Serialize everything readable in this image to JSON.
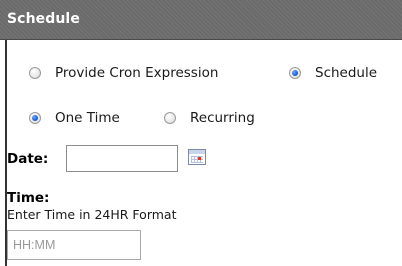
{
  "header": {
    "title": "Schedule"
  },
  "schedule_mode": {
    "options": [
      {
        "label": "Provide Cron Expression",
        "checked": false
      },
      {
        "label": "Schedule",
        "checked": true
      }
    ]
  },
  "frequency": {
    "options": [
      {
        "label": "One Time",
        "checked": true
      },
      {
        "label": "Recurring",
        "checked": false
      }
    ]
  },
  "date": {
    "label": "Date:",
    "value": "",
    "icon": "calendar-icon"
  },
  "time": {
    "label": "Time:",
    "helper": "Enter Time in 24HR Format",
    "placeholder": "HH:MM",
    "value": ""
  },
  "colors": {
    "header_bg": "#6b6b6b",
    "header_text": "#ffffff",
    "radio_selected": "#1f5fd6"
  }
}
